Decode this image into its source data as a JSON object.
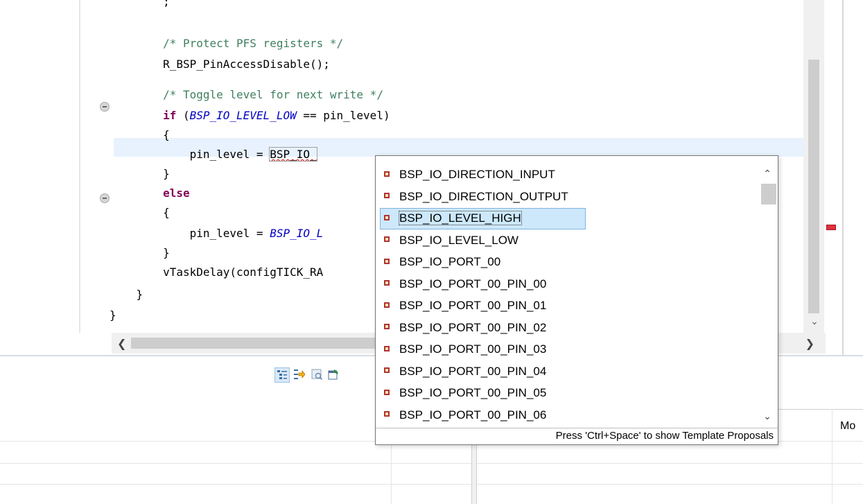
{
  "editor": {
    "lines": [
      {
        "id": "line-partial",
        "segments": [
          {
            "t": "plain",
            "v": "        ;"
          }
        ]
      },
      {
        "id": "line-comment-pfs",
        "segments": [
          {
            "t": "cm",
            "v": "        /* Protect PFS registers */"
          }
        ]
      },
      {
        "id": "line-disable",
        "segments": [
          {
            "t": "plain",
            "v": "        R_BSP_PinAccessDisable();"
          }
        ]
      },
      {
        "id": "line-comment-toggle",
        "segments": [
          {
            "t": "cm",
            "v": "        /* Toggle level for next write */"
          }
        ]
      },
      {
        "id": "line-if",
        "segments": [
          {
            "t": "plain",
            "v": "        "
          },
          {
            "t": "kw",
            "v": "if"
          },
          {
            "t": "plain",
            "v": " ("
          },
          {
            "t": "mac",
            "v": "BSP_IO_LEVEL_LOW"
          },
          {
            "t": "plain",
            "v": " == pin_level)"
          }
        ]
      },
      {
        "id": "line-brace-open-1",
        "segments": [
          {
            "t": "plain",
            "v": "        {"
          }
        ]
      },
      {
        "id": "line-current",
        "segments": [
          {
            "t": "plain",
            "v": "            pin_level = "
          },
          {
            "t": "err",
            "v": "BSP_IO_"
          }
        ]
      },
      {
        "id": "line-brace-close-1",
        "segments": [
          {
            "t": "plain",
            "v": "        }"
          }
        ]
      },
      {
        "id": "line-else",
        "segments": [
          {
            "t": "kw",
            "v": "        else"
          }
        ]
      },
      {
        "id": "line-brace-open-2",
        "segments": [
          {
            "t": "plain",
            "v": "        {"
          }
        ]
      },
      {
        "id": "line-assign-low",
        "segments": [
          {
            "t": "plain",
            "v": "            pin_level = "
          },
          {
            "t": "mac",
            "v": "BSP_IO_L"
          }
        ]
      },
      {
        "id": "line-brace-close-2",
        "segments": [
          {
            "t": "plain",
            "v": "        }"
          }
        ]
      },
      {
        "id": "line-blank",
        "segments": [
          {
            "t": "plain",
            "v": ""
          }
        ]
      },
      {
        "id": "line-delay",
        "segments": [
          {
            "t": "plain",
            "v": "        vTaskDelay(configTICK_RA"
          }
        ]
      },
      {
        "id": "line-brace-close-3",
        "segments": [
          {
            "t": "plain",
            "v": "    }"
          }
        ]
      },
      {
        "id": "line-brace-close-4",
        "segments": [
          {
            "t": "plain",
            "v": "}"
          }
        ]
      }
    ]
  },
  "content_assist": {
    "proposals": [
      "BSP_IO_DIRECTION_INPUT",
      "BSP_IO_DIRECTION_OUTPUT",
      "BSP_IO_LEVEL_HIGH",
      "BSP_IO_LEVEL_LOW",
      "BSP_IO_PORT_00",
      "BSP_IO_PORT_00_PIN_00",
      "BSP_IO_PORT_00_PIN_01",
      "BSP_IO_PORT_00_PIN_02",
      "BSP_IO_PORT_00_PIN_03",
      "BSP_IO_PORT_00_PIN_04",
      "BSP_IO_PORT_00_PIN_05",
      "BSP_IO_PORT_00_PIN_06"
    ],
    "selected_index": 2,
    "status_text": "Press 'Ctrl+Space' to show Template Proposals",
    "proposal_icon": "define-macro-icon"
  },
  "bottom_panel": {
    "column_header_partial": "Mo",
    "toolbar_icons": [
      "tree-view-icon",
      "sync-icon",
      "filter-icon",
      "edit-icon"
    ]
  },
  "colors": {
    "keyword": "#7f0055",
    "comment": "#3f7f5f",
    "macro": "#0000c0",
    "selection": "#cde8fb",
    "current_line": "#e8f2fe"
  }
}
